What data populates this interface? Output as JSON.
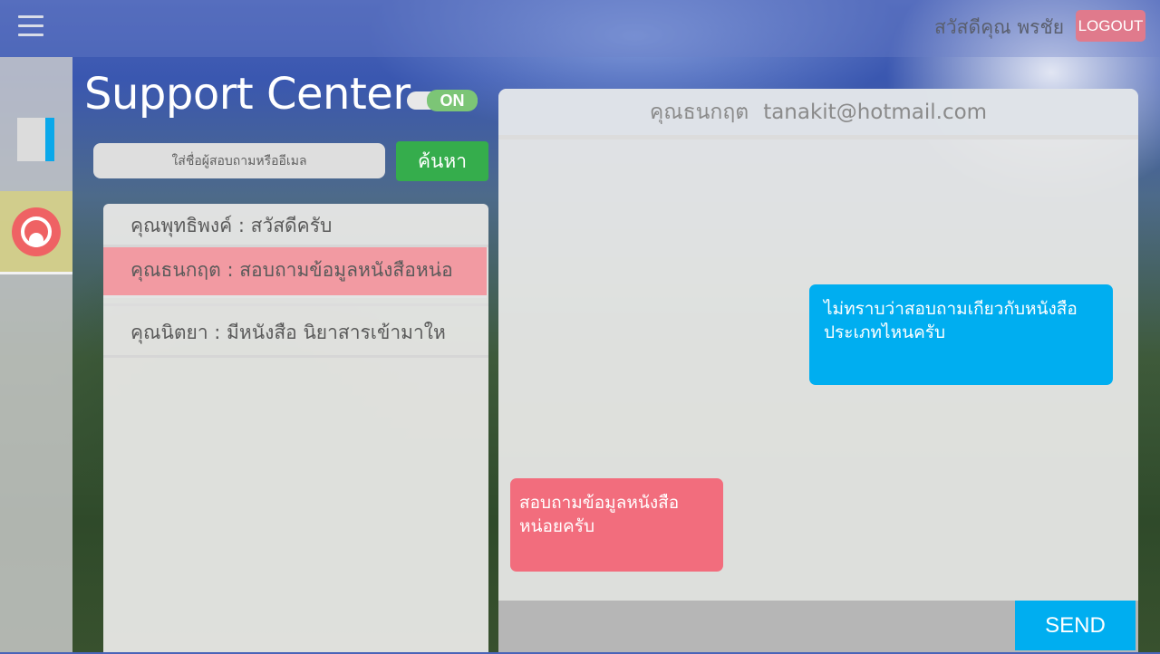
{
  "topbar": {
    "menu_icon": "hamburger-menu-icon",
    "greeting": "สวัสดีคุณ พรชัย",
    "logout_label": "LOGOUT"
  },
  "sidebar": {
    "items": [
      {
        "icon": "document-icon"
      },
      {
        "icon": "support-chat-icon",
        "active": true
      }
    ]
  },
  "header": {
    "title": "Support Center",
    "toggle_label": "ON"
  },
  "search": {
    "placeholder": "ใส่ชื่อผู้สอบถามหรืออีเมล",
    "button_label": "ค้นหา"
  },
  "conversations": [
    {
      "name": "คุณพุทธิพงค์",
      "preview": "คุณพุทธิพงค์ : สวัสดีครับ"
    },
    {
      "name": "คุณธนกฤต",
      "preview": "คุณธนกฤต  : สอบถามข้อมูลหนังสือหน่อ",
      "selected": true
    },
    {
      "name": "คุณนิตยา",
      "preview": "คุณนิตยา  : มีหนังสือ นิยาสารเข้ามาให"
    }
  ],
  "chat": {
    "contact_name": "คุณธนกฤต",
    "contact_email": "tanakit@hotmail.com",
    "messages": [
      {
        "from": "agent",
        "text": "ไม่ทราบว่าสอบถามเกียวกับหนังสือประเภทไหนครับ"
      },
      {
        "from": "customer",
        "text": "สอบถามข้อมูลหนังสือหน่อยครับ"
      }
    ],
    "send_label": "SEND"
  },
  "colors": {
    "accent_blue": "#00aef0",
    "logout_pink": "#e07a8c",
    "search_green": "#35ad4c",
    "toggle_green": "#7cc576",
    "selected_row": "#f29aa2",
    "customer_bubble": "#f26d7d"
  }
}
